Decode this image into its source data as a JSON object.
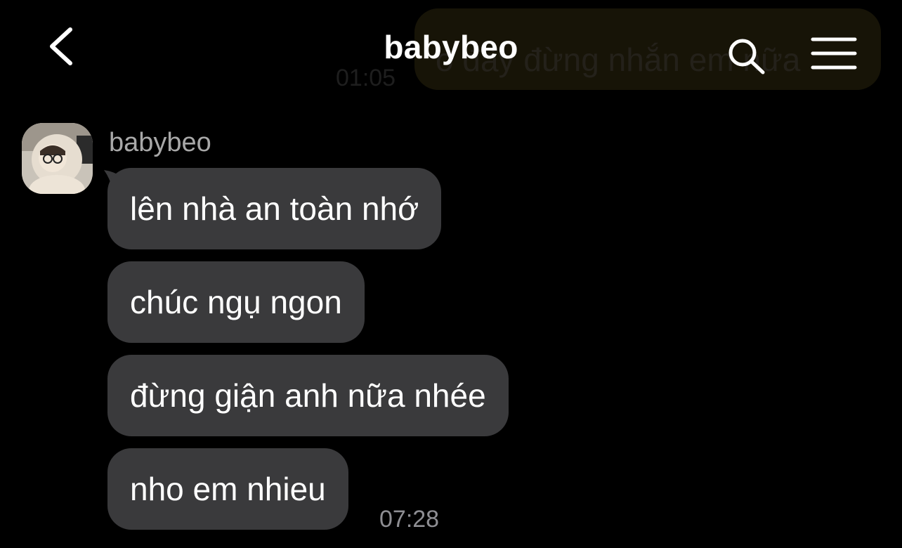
{
  "header": {
    "title": "babybeo",
    "back_icon": "chevron-left-icon",
    "search_icon": "search-icon",
    "menu_icon": "hamburger-menu-icon"
  },
  "previous_message": {
    "text": "o đây đừng nhắn em nữa",
    "time": "01:05"
  },
  "thread": {
    "sender_name": "babybeo",
    "messages": [
      {
        "text": "lên nhà an toàn nhớ"
      },
      {
        "text": "chúc ngụ ngon"
      },
      {
        "text": "đừng giận anh nữa nhée"
      },
      {
        "text": "nho em nhieu"
      }
    ],
    "last_time": "07:28"
  },
  "colors": {
    "background": "#000000",
    "bubble": "#3a3a3c",
    "text": "#ffffff",
    "muted": "#8e8e93"
  }
}
